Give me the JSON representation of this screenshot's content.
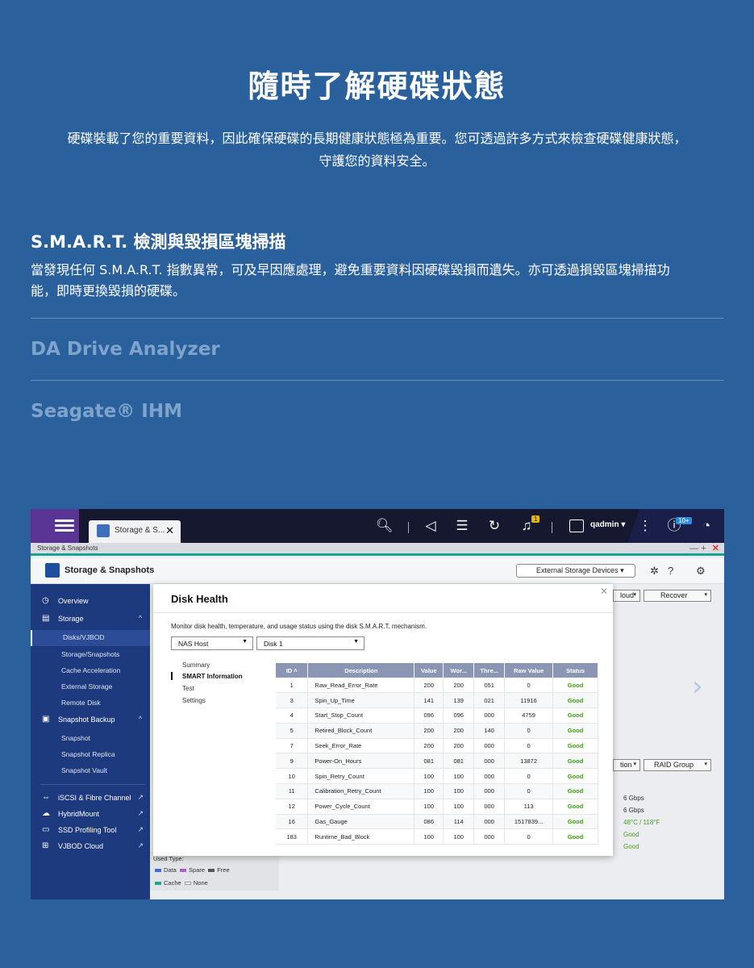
{
  "hero": {
    "title": "隨時了解硬碟狀態",
    "desc_line1": "硬碟裝載了您的重要資料，因此確保硬碟的長期健康狀態極為重要。您可透過許多方式來檢查硬碟健康狀態，",
    "desc_line2": "守護您的資料安全。"
  },
  "features": {
    "smart_title": "S.M.A.R.T. 檢測與毀損區塊掃描",
    "smart_desc_line1": "當發現任何 S.M.A.R.T. 指數異常，可及早因應處理，避免重要資料因硬碟毀損而遺失。亦可透過損毀區塊掃描功",
    "smart_desc_line2": "能，即時更換毀損的硬碟。",
    "da_title": "DA Drive Analyzer",
    "seagate_title": "Seagate® IHM"
  },
  "app": {
    "tab_title": "Storage & S...",
    "username": "qadmin",
    "notif_badge": "1",
    "count_badge": "10+",
    "breadcrumb": "Storage & Snapshots",
    "header_name": "Storage & Snapshots",
    "external_devices_label": "External Storage Devices",
    "sidebar": {
      "overview": "Overview",
      "storage": "Storage",
      "disks": "Disks/VJBOD",
      "storage_snapshots": "Storage/Snapshots",
      "cache": "Cache Acceleration",
      "external_storage": "External Storage",
      "remote_disk": "Remote Disk",
      "snapshot_backup": "Snapshot Backup",
      "snapshot": "Snapshot",
      "snapshot_replica": "Snapshot Replica",
      "snapshot_vault": "Snapshot Vault",
      "iscsi": "iSCSI & Fibre Channel",
      "hybridmount": "HybridMount",
      "ssd_profiling": "SSD Profiling Tool",
      "vjbod_cloud": "VJBOD Cloud"
    },
    "bg": {
      "cloud_sel": "loud",
      "recover_sel": "Recover",
      "action_sel": "tion",
      "raid_sel": "RAID Group",
      "speed1": "6 Gbps",
      "speed2": "6 Gbps",
      "temp": "48°C / 118°F",
      "good1": "Good",
      "good2": "Good",
      "used_type": "Used Type:",
      "legend_data": "Data",
      "legend_spare": "Spare",
      "legend_free": "Free",
      "legend_cache": "Cache",
      "legend_none": "None"
    },
    "dialog": {
      "title": "Disk Health",
      "desc": "Monitor disk health, temperature, and usage status using the disk S.M.A.R.T. mechanism.",
      "host_sel": "NAS Host",
      "disk_sel": "Disk 1",
      "menu_summary": "Summary",
      "menu_smart": "SMART Information",
      "menu_test": "Test",
      "menu_settings": "Settings",
      "columns": [
        "ID",
        "Description",
        "Value",
        "Wor...",
        "Thre...",
        "Raw Value",
        "Status"
      ],
      "rows": [
        [
          "1",
          "Raw_Read_Error_Rate",
          "200",
          "200",
          "051",
          "0",
          "Good"
        ],
        [
          "3",
          "Spin_Up_Time",
          "141",
          "139",
          "021",
          "11916",
          "Good"
        ],
        [
          "4",
          "Start_Stop_Count",
          "096",
          "096",
          "000",
          "4759",
          "Good"
        ],
        [
          "5",
          "Retired_Block_Count",
          "200",
          "200",
          "140",
          "0",
          "Good"
        ],
        [
          "7",
          "Seek_Error_Rate",
          "200",
          "200",
          "000",
          "0",
          "Good"
        ],
        [
          "9",
          "Power-On_Hours",
          "081",
          "081",
          "000",
          "13872",
          "Good"
        ],
        [
          "10",
          "Spin_Retry_Count",
          "100",
          "100",
          "000",
          "0",
          "Good"
        ],
        [
          "11",
          "Calibration_Retry_Count",
          "100",
          "100",
          "000",
          "0",
          "Good"
        ],
        [
          "12",
          "Power_Cycle_Count",
          "100",
          "100",
          "000",
          "113",
          "Good"
        ],
        [
          "16",
          "Gas_Gauge",
          "086",
          "114",
          "000",
          "1517839...",
          "Good"
        ],
        [
          "183",
          "Runtime_Bad_Block",
          "100",
          "100",
          "000",
          "0",
          "Good"
        ]
      ]
    }
  },
  "colors": {
    "page_bg": "#2a609c",
    "sidebar_bg": "#1d3a7e",
    "good": "#3aa015",
    "accent_teal": "#14a48f"
  }
}
